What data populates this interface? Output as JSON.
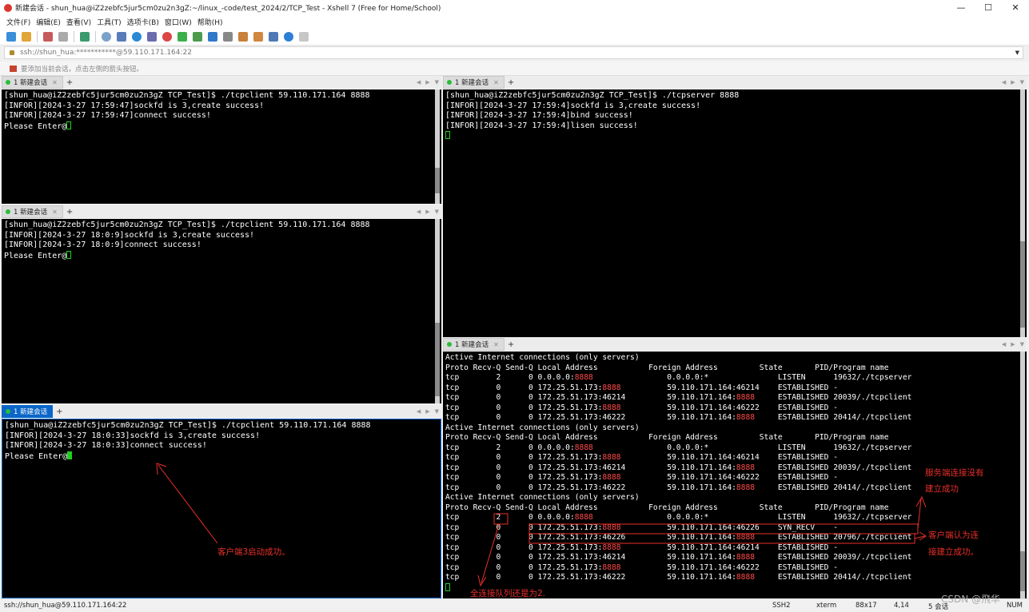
{
  "window": {
    "title": "新建会话 - shun_hua@iZ2zebfc5jur5cm0zu2n3gZ:~/linux_-code/test_2024/2/TCP_Test - Xshell 7 (Free for Home/School)",
    "min": "—",
    "max": "☐",
    "close": "✕"
  },
  "menu": [
    "文件(F)",
    "编辑(E)",
    "查看(V)",
    "工具(T)",
    "选项卡(B)",
    "窗口(W)",
    "帮助(H)"
  ],
  "address": {
    "value": "ssh://shun_hua:***********@59.110.171.164:22"
  },
  "hint": "要添加当前会话，点击左侧的箭头按钮。",
  "tab_label": "1 新建会话",
  "tab_close": "✕",
  "tab_plus": "+",
  "panes": {
    "p1": [
      "[shun_hua@iZ2zebfc5jur5cm0zu2n3gZ TCP_Test]$ ./tcpclient 59.110.171.164 8888",
      "[INFOR][2024-3-27 17:59:47]sockfd is 3,create success!",
      "[INFOR][2024-3-27 17:59:47]connect success!",
      "Please Enter@"
    ],
    "p2": [
      "[shun_hua@iZ2zebfc5jur5cm0zu2n3gZ TCP_Test]$ ./tcpclient 59.110.171.164 8888",
      "[INFOR][2024-3-27 18:0:9]sockfd is 3,create success!",
      "[INFOR][2024-3-27 18:0:9]connect success!",
      "Please Enter@"
    ],
    "p3": [
      "[shun_hua@iZ2zebfc5jur5cm0zu2n3gZ TCP_Test]$ ./tcpclient 59.110.171.164 8888",
      "[INFOR][2024-3-27 18:0:33]sockfd is 3,create success!",
      "[INFOR][2024-3-27 18:0:33]connect success!",
      "Please Enter@"
    ],
    "p4": [
      "[shun_hua@iZ2zebfc5jur5cm0zu2n3gZ TCP_Test]$ ./tcpserver 8888",
      "[INFOR][2024-3-27 17:59:4]sockfd is 3,create success!",
      "[INFOR][2024-3-27 17:59:4]bind success!",
      "[INFOR][2024-3-27 17:59:4]lisen success!"
    ]
  },
  "netstat": {
    "header1": "Active Internet connections (only servers)",
    "header2": "Proto Recv-Q Send-Q Local Address           Foreign Address         State       PID/Program name",
    "blocks": [
      [
        [
          "tcp        2      0 0.0.0.0:",
          "8888",
          "                0.0.0.0:*               LISTEN      19632/./tcpserver"
        ],
        [
          "tcp        0      0 172.25.51.173:",
          "8888",
          "          59.110.171.164:46214    ESTABLISHED -"
        ],
        [
          "tcp        0      0 172.25.51.173:46214         59.110.171.164:",
          "8888",
          "     ESTABLISHED 20039/./tcpclient"
        ],
        [
          "tcp        0      0 172.25.51.173:",
          "8888",
          "          59.110.171.164:46222    ESTABLISHED -"
        ],
        [
          "tcp        0      0 172.25.51.173:46222         59.110.171.164:",
          "8888",
          "     ESTABLISHED 20414/./tcpclient"
        ]
      ],
      [
        [
          "tcp        2      0 0.0.0.0:",
          "8888",
          "                0.0.0.0:*               LISTEN      19632/./tcpserver"
        ],
        [
          "tcp        0      0 172.25.51.173:",
          "8888",
          "          59.110.171.164:46214    ESTABLISHED -"
        ],
        [
          "tcp        0      0 172.25.51.173:46214         59.110.171.164:",
          "8888",
          "     ESTABLISHED 20039/./tcpclient"
        ],
        [
          "tcp        0      0 172.25.51.173:",
          "8888",
          "          59.110.171.164:46222    ESTABLISHED -"
        ],
        [
          "tcp        0      0 172.25.51.173:46222         59.110.171.164:",
          "8888",
          "     ESTABLISHED 20414/./tcpclient"
        ]
      ],
      [
        [
          "tcp        2      0 0.0.0.0:",
          "8888",
          "                0.0.0.0:*               LISTEN      19632/./tcpserver"
        ],
        [
          "tcp        0      0 172.25.51.173:",
          "8888",
          "          59.110.171.164:46226    SYN_RECV    -"
        ],
        [
          "tcp        0      0 172.25.51.173:46226         59.110.171.164:",
          "8888",
          "     ESTABLISHED 20796/./tcpclient"
        ],
        [
          "tcp        0      0 172.25.51.173:",
          "8888",
          "          59.110.171.164:46214    ESTABLISHED -"
        ],
        [
          "tcp        0      0 172.25.51.173:46214         59.110.171.164:",
          "8888",
          "     ESTABLISHED 20039/./tcpclient"
        ],
        [
          "tcp        0      0 172.25.51.173:",
          "8888",
          "          59.110.171.164:46222    ESTABLISHED -"
        ],
        [
          "tcp        0      0 172.25.51.173:46222         59.110.171.164:",
          "8888",
          "     ESTABLISHED 20414/./tcpclient"
        ]
      ]
    ]
  },
  "annotations": {
    "client3": "客户端3启动成功。",
    "server1": "服务端连接没有",
    "server2": "建立成功",
    "client1": "客户端认为连",
    "client2": "接建立成功。",
    "queue": "全连接队列还是为2."
  },
  "status": {
    "host": "ssh://shun_hua@59.110.171.164:22",
    "proto": "SSH2",
    "term": "xterm",
    "size": "88x17",
    "pos": "4,14",
    "sessions": "5 会话",
    "num": "NUM"
  },
  "watermark": "CSDN @飛华"
}
